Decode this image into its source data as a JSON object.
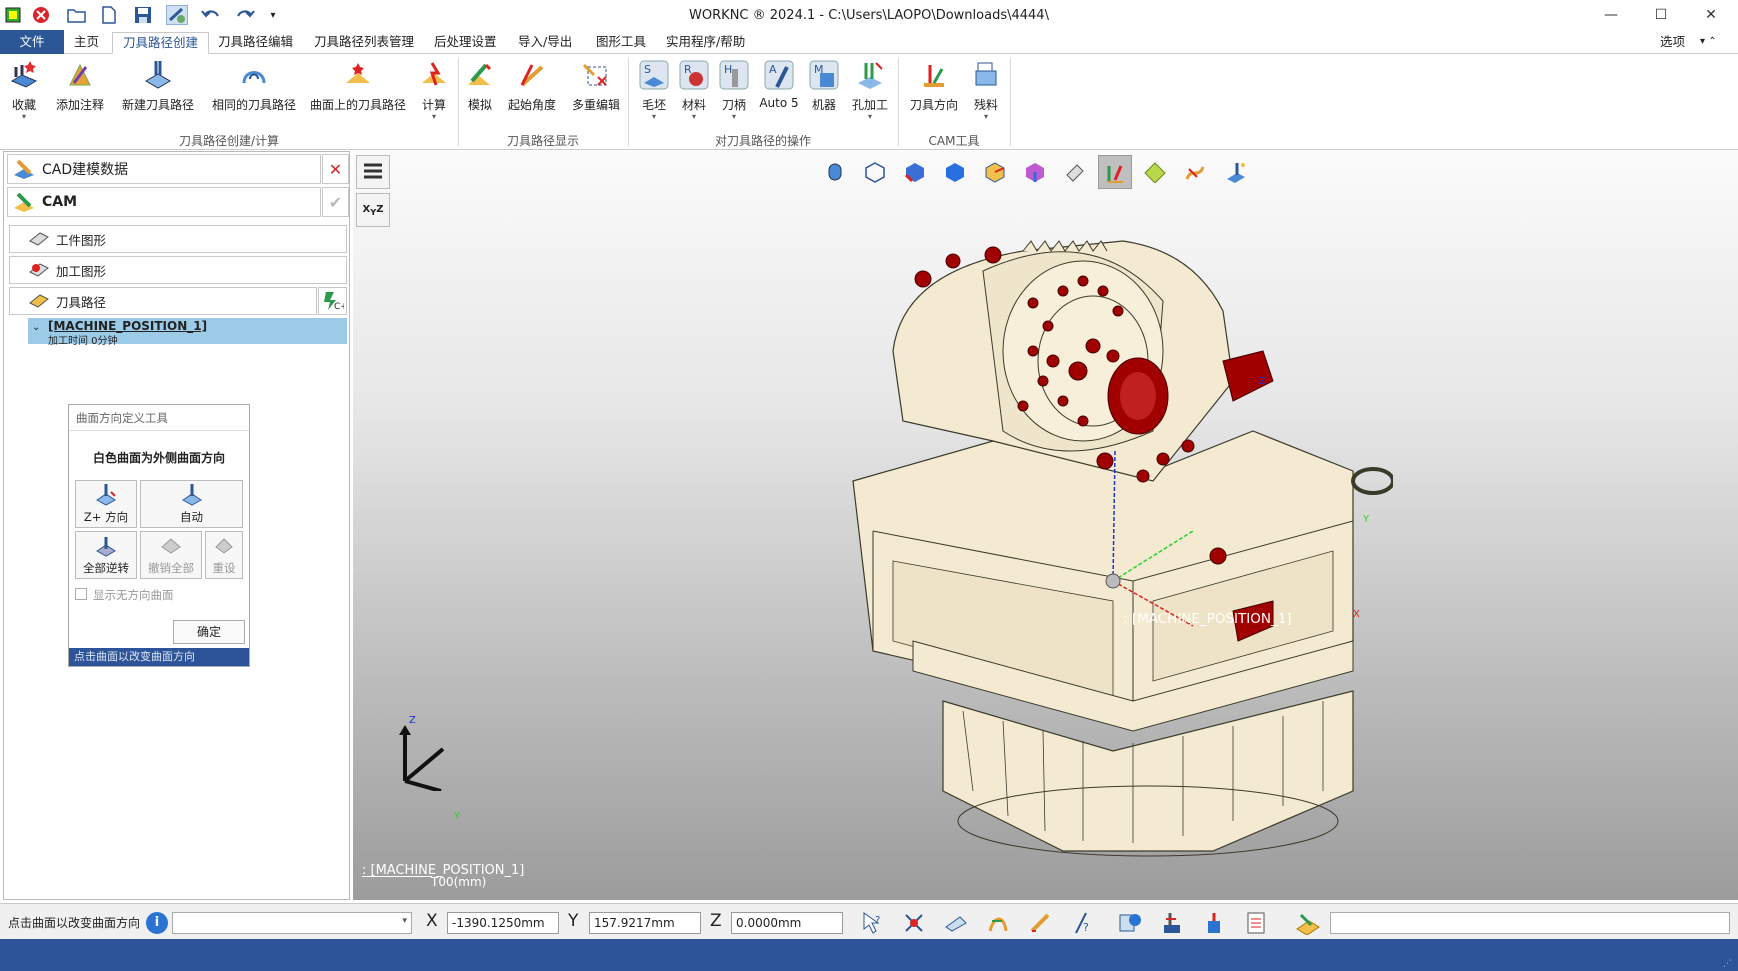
{
  "window": {
    "title": "WORKNC ® 2024.1 - C:\\Users\\LAOPO\\Downloads\\4444\\",
    "controls": {
      "minimize": "—",
      "maximize": "☐",
      "close": "✕"
    }
  },
  "menu": {
    "tabs": [
      "文件",
      "主页",
      "刀具路径创建",
      "刀具路径编辑",
      "刀具路径列表管理",
      "后处理设置",
      "导入/导出",
      "图形工具",
      "实用程序/帮助"
    ],
    "active_tab": "刀具路径创建",
    "options_label": "选项",
    "options_arrows": "▾ ⌃"
  },
  "ribbon": {
    "buttons": {
      "fav": "收藏",
      "annot": "添加注释",
      "newtp": "新建刀具路径",
      "sametp": "相同的刀具路径",
      "surftp": "曲面上的刀具路径",
      "calc": "计算",
      "sim": "模拟",
      "angle": "起始角度",
      "multiedit": "多重编辑",
      "stock": "毛坯",
      "material": "材料",
      "holder": "刀柄",
      "auto5": "Auto 5",
      "machine": "机器",
      "hole": "孔加工",
      "tooldir": "刀具方向",
      "remain": "残料"
    },
    "groups": {
      "create": "刀具路径创建/计算",
      "display": "刀具路径显示",
      "ops": "对刀具路径的操作",
      "camtools": "CAM工具"
    }
  },
  "left_panel": {
    "cad_label": "CAD建模数据",
    "cam_label": "CAM",
    "items": {
      "workpiece": "工件图形",
      "machining": "加工图形",
      "toolpath": "刀具路径"
    },
    "machine_position": "[MACHINE_POSITION_1]",
    "machining_time": "加工时间 0分钟"
  },
  "dialog": {
    "title": "曲面方向定义工具",
    "heading": "白色曲面为外侧曲面方向",
    "btn_zplus": "Z+ 方向",
    "btn_auto": "自动",
    "btn_reverse": "全部逆转",
    "btn_undo": "撤销全部",
    "btn_reset": "重设",
    "checkbox_label": "显示无方向曲面",
    "ok": "确定",
    "status": "点击曲面以改变曲面方向"
  },
  "viewport": {
    "model_label": ": [MACHINE_POSITION_1]",
    "triad_label": ": [MACHINE_POSITION_1]",
    "tool_label": "T00(mm)",
    "axis_x": "X",
    "axis_y": "Y",
    "axis_z": "Z"
  },
  "statusbar": {
    "hint": "点击曲面以改变曲面方向",
    "x_label": "X",
    "y_label": "Y",
    "z_label": "Z",
    "x_value": "-1390.1250mm",
    "y_value": "157.9217mm",
    "z_value": "0.0000mm"
  },
  "colors": {
    "accent": "#2b5797",
    "status_bar": "#2d5499",
    "tree_selected": "#9ccbe8",
    "model_body": "#f3ead1",
    "model_red": "#a00000"
  }
}
